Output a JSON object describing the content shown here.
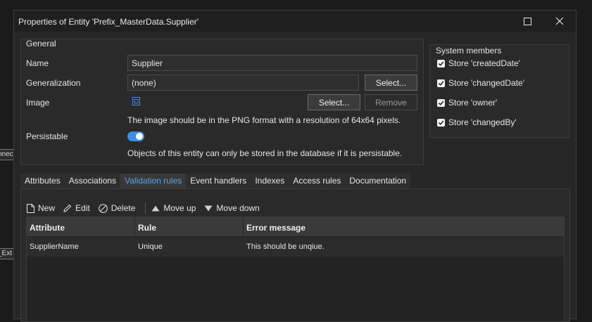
{
  "background": {
    "fragment_top": "nnec",
    "fragment_bottom": "_Ext"
  },
  "window": {
    "title": "Properties of Entity 'Prefix_MasterData.Supplier'",
    "maximize_icon": "maximize-icon",
    "close_icon": "close-icon"
  },
  "general": {
    "legend": "General",
    "name_label": "Name",
    "name_value": "Supplier",
    "generalization_label": "Generalization",
    "generalization_value": "(none)",
    "generalization_select": "Select...",
    "image_label": "Image",
    "image_select": "Select...",
    "image_remove": "Remove",
    "image_hint": "The image should be in the PNG format with a resolution of 64x64 pixels.",
    "persistable_label": "Persistable",
    "persistable_on": true,
    "persistable_hint": "Objects of this entity can only be stored in the database if it is persistable."
  },
  "system_members": {
    "legend": "System members",
    "items": [
      {
        "label": "Store 'createdDate'",
        "checked": true
      },
      {
        "label": "Store 'changedDate'",
        "checked": true
      },
      {
        "label": "Store 'owner'",
        "checked": true
      },
      {
        "label": "Store 'changedBy'",
        "checked": true
      }
    ]
  },
  "tabs": [
    {
      "label": "Attributes",
      "active": false
    },
    {
      "label": "Associations",
      "active": false
    },
    {
      "label": "Validation rules",
      "active": true
    },
    {
      "label": "Event handlers",
      "active": false
    },
    {
      "label": "Indexes",
      "active": false
    },
    {
      "label": "Access rules",
      "active": false
    },
    {
      "label": "Documentation",
      "active": false
    }
  ],
  "toolbar": {
    "new_label": "New",
    "edit_label": "Edit",
    "delete_label": "Delete",
    "move_up_label": "Move up",
    "move_down_label": "Move down"
  },
  "grid": {
    "columns": [
      "Attribute",
      "Rule",
      "Error message"
    ],
    "rows": [
      {
        "attribute": "SupplierName",
        "rule": "Unique",
        "error_message": "This should be unqiue."
      }
    ]
  },
  "colors": {
    "accent": "#56a5ee",
    "toggle_on": "#3d8fe6",
    "dialog_bg": "#262626"
  }
}
